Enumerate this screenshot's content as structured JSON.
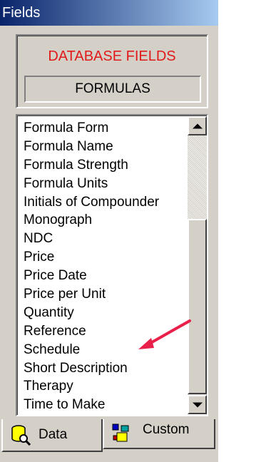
{
  "window": {
    "title": "Fields"
  },
  "header": {
    "title": "DATABASE FIELDS",
    "subtitle": "FORMULAS",
    "title_color": "#e11919"
  },
  "fields": [
    "Formula Form",
    "Formula Name",
    "Formula Strength",
    "Formula Units",
    "Initials of Compounder",
    "Monograph",
    "NDC",
    "Price",
    "Price Date",
    "Price per Unit",
    "Quantity",
    "Reference",
    "Schedule",
    "Short Description",
    "Therapy",
    "Time to Make"
  ],
  "tabs": [
    {
      "label": "Data",
      "icon": "database-magnifier-icon",
      "selected": true
    },
    {
      "label": "Custom",
      "icon": "custom-blocks-icon",
      "selected": false
    }
  ],
  "annotation": {
    "icon": "red-arrow-icon",
    "color": "#e8204a",
    "points_to": "Short Description"
  }
}
